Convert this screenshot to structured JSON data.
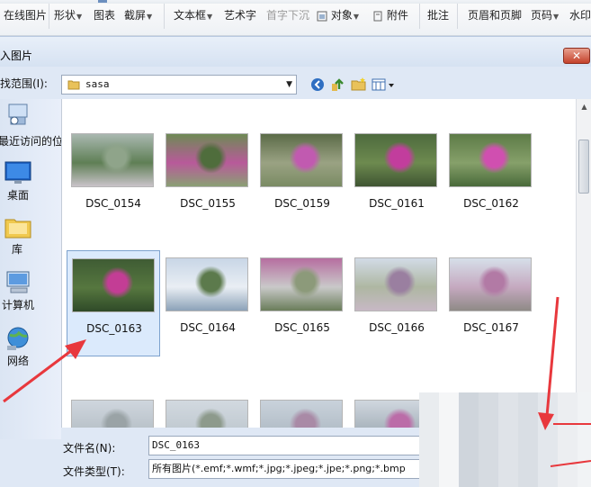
{
  "ribbon": {
    "items": [
      {
        "label": "在线图片",
        "dropdown": false
      },
      {
        "label": "形状",
        "dropdown": true
      },
      {
        "label": "图表",
        "dropdown": false
      },
      {
        "label": "截屏",
        "dropdown": true
      },
      {
        "label": "文本框",
        "dropdown": true
      },
      {
        "label": "艺术字",
        "dropdown": false
      },
      {
        "label": "首字下沉",
        "dropdown": false,
        "disabled": true
      },
      {
        "label": "对象",
        "dropdown": true
      },
      {
        "label": "附件",
        "dropdown": false
      },
      {
        "label": "批注",
        "dropdown": false
      },
      {
        "label": "页眉和页脚",
        "dropdown": false
      },
      {
        "label": "页码",
        "dropdown": true
      },
      {
        "label": "水印",
        "dropdown": false
      }
    ]
  },
  "dialog": {
    "title": "插入图片",
    "close_glyph": "✕",
    "look_in_label": "查找范围(I):",
    "look_in_value": "sasa",
    "places": [
      {
        "label": "最近访问的位置",
        "icon": "recent-places-icon"
      },
      {
        "label": "桌面",
        "icon": "desktop-icon"
      },
      {
        "label": "库",
        "icon": "library-icon"
      },
      {
        "label": "计算机",
        "icon": "computer-icon"
      },
      {
        "label": "网络",
        "icon": "network-icon"
      }
    ],
    "files": [
      {
        "name": "DSC_0154",
        "colors": [
          "#a9b8b0",
          "#8fa48a",
          "#5f7f55",
          "#c9c3c9"
        ]
      },
      {
        "name": "DSC_0155",
        "colors": [
          "#6e8a55",
          "#4f6d3c",
          "#b85a9a",
          "#8aa074"
        ]
      },
      {
        "name": "DSC_0159",
        "colors": [
          "#5b6b48",
          "#c15ab0",
          "#9aa283",
          "#7a8b63"
        ]
      },
      {
        "name": "DSC_0161",
        "colors": [
          "#4d6a3e",
          "#c23d9d",
          "#6d8a4f",
          "#3f5532"
        ]
      },
      {
        "name": "DSC_0162",
        "colors": [
          "#5d7b47",
          "#d04fb0",
          "#86a06a",
          "#496a3a"
        ]
      },
      {
        "name": "DSC_0163",
        "colors": [
          "#3f5c34",
          "#c33d95",
          "#56773f",
          "#2f4a28"
        ]
      },
      {
        "name": "DSC_0164",
        "colors": [
          "#c8d6e6",
          "#5c7a4c",
          "#e9eef4",
          "#8ca2b8"
        ]
      },
      {
        "name": "DSC_0165",
        "colors": [
          "#b66ea0",
          "#8c9a7a",
          "#c9c9c9",
          "#6a7d5a"
        ]
      },
      {
        "name": "DSC_0166",
        "colors": [
          "#d2dbe6",
          "#9a7fa0",
          "#aeb7a2",
          "#c7b8c5"
        ]
      },
      {
        "name": "DSC_0167",
        "colors": [
          "#d6dfe9",
          "#b27aa5",
          "#c5a9c0",
          "#8f8a86"
        ]
      },
      {
        "name": "",
        "colors": [
          "#cfd6de",
          "#9aa3a6",
          "#b9c2c9",
          "#7c8a90"
        ]
      },
      {
        "name": "",
        "colors": [
          "#d2d9e0",
          "#8d9a8c",
          "#c1cad1",
          "#6f7f72"
        ]
      },
      {
        "name": "",
        "colors": [
          "#c9d2db",
          "#a98aa6",
          "#b3bec8",
          "#7d8c95"
        ]
      },
      {
        "name": "",
        "colors": [
          "#d0d7df",
          "#bb6ca8",
          "#a8b3bc",
          "#6c7b84"
        ]
      },
      {
        "name": "",
        "colors": [
          "#cad3dc",
          "#b07fa6",
          "#c1c8cf",
          "#88939b"
        ]
      }
    ],
    "selected_file": "DSC_0163",
    "filename_label": "文件名(N):",
    "filename_value": "DSC_0163",
    "filetype_label": "文件类型(T):",
    "filetype_value": "所有图片(*.emf;*.wmf;*.jpg;*.jpeg;*.jpe;*.png;*.bmp"
  },
  "colors": {
    "annotation_arrow": "#e8383d",
    "selection_fill": "#dbeafc",
    "selection_border": "#7da2ce"
  }
}
